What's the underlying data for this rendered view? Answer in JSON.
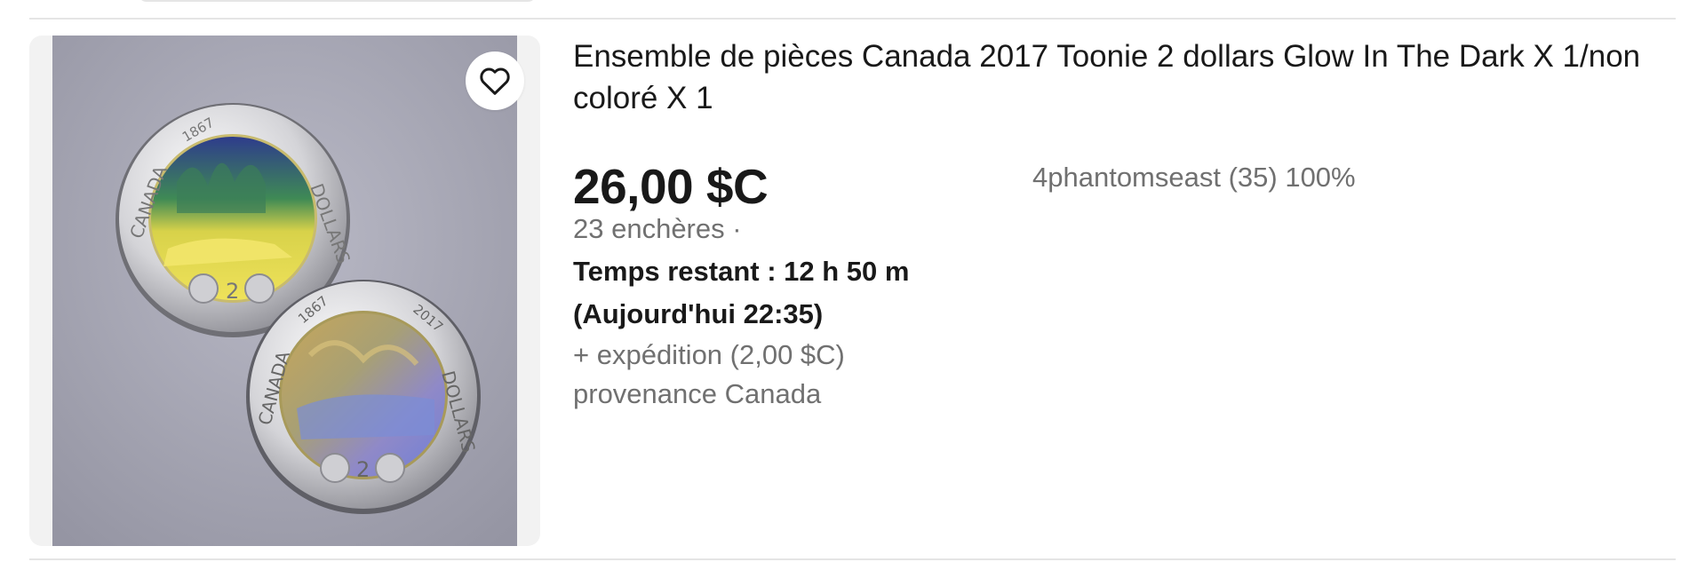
{
  "listing": {
    "title": "Ensemble de pièces Canada 2017 Toonie 2 dollars Glow In The Dark X 1/non coloré X 1",
    "price": "26,00 $C",
    "bids": "23 enchères ·",
    "time_left": "Temps restant : 12 h 50 m",
    "end_time": "(Aujourd'hui 22:35)",
    "shipping": "+ expédition (2,00 $C)",
    "origin": "provenance Canada",
    "seller": "4phantomseast (35) 100%",
    "image": {
      "coin1": {
        "left": "CANADA",
        "right": "DOLLARS",
        "year": "1867",
        "value": "2"
      },
      "coin2": {
        "left": "CANADA",
        "right": "DOLLARS",
        "year_left": "1867",
        "year_right": "2017",
        "value": "2"
      }
    },
    "watch_icon": "heart-icon"
  }
}
